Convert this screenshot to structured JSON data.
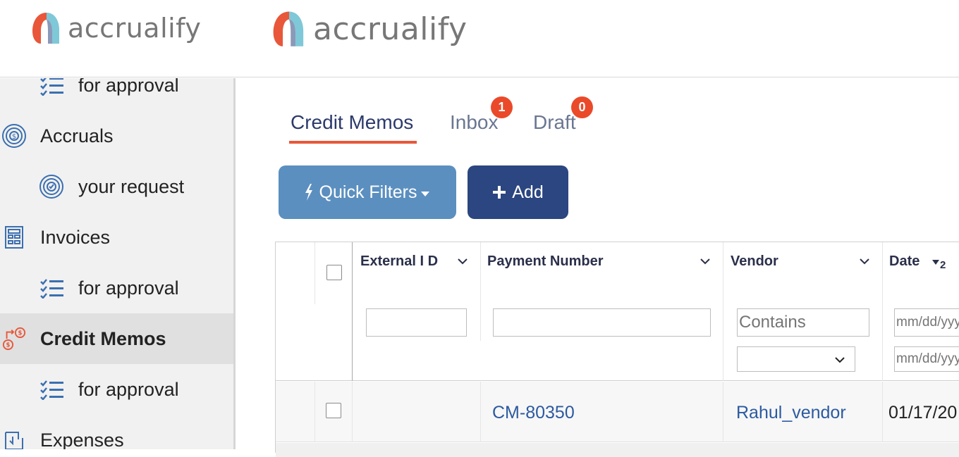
{
  "app": {
    "logo_text": "accrualify",
    "brand_colors": {
      "orange": "#e8573a",
      "teal": "#7fc8d8",
      "navy": "#2b4680"
    }
  },
  "sidebar": {
    "items": [
      {
        "label": "for approval",
        "icon": "checklist-icon",
        "level": "child"
      },
      {
        "label": "Accruals",
        "icon": "target-icon",
        "level": "parent"
      },
      {
        "label": "your request",
        "icon": "target-check-icon",
        "level": "child"
      },
      {
        "label": "Invoices",
        "icon": "invoice-icon",
        "level": "parent"
      },
      {
        "label": "for approval",
        "icon": "checklist-icon",
        "level": "child"
      },
      {
        "label": "Credit Memos",
        "icon": "credit-memo-icon",
        "level": "parent",
        "active": true
      },
      {
        "label": "for approval",
        "icon": "checklist-icon",
        "level": "child"
      },
      {
        "label": "Expenses",
        "icon": "expenses-icon",
        "level": "parent"
      }
    ]
  },
  "tabs": [
    {
      "label": "Credit Memos",
      "active": true
    },
    {
      "label": "Inbox",
      "badge": "1"
    },
    {
      "label": "Draft",
      "badge": "0"
    }
  ],
  "toolbar": {
    "quick_filters_label": "Quick Filters",
    "add_label": "Add"
  },
  "grid": {
    "columns": [
      {
        "title": "External I D"
      },
      {
        "title": "Payment Number"
      },
      {
        "title": "Vendor"
      },
      {
        "title": "Date",
        "sort_index": "2"
      }
    ],
    "filters": {
      "vendor_placeholder": "Contains",
      "date_placeholder": "mm/dd/yyyy",
      "date_placeholder_2": "mm/dd/yyyy"
    },
    "rows": [
      {
        "external_id": "",
        "payment_number": "CM-80350",
        "vendor": "Rahul_vendor",
        "date": "01/17/20"
      }
    ]
  }
}
